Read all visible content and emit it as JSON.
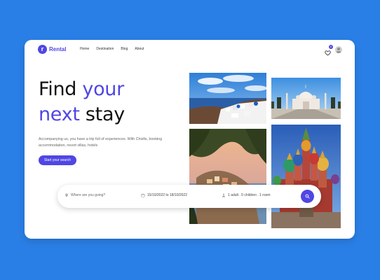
{
  "brand": {
    "logo_letter": "r",
    "name": "Rental",
    "accent": "#5046e4"
  },
  "nav": {
    "items": [
      "Home",
      "Destination",
      "Blog",
      "About"
    ]
  },
  "header": {
    "favorites_count": "0"
  },
  "hero": {
    "title_line1_a": "Find ",
    "title_line1_b": "your",
    "title_line2_a": "next",
    "title_line2_b": " stay",
    "description": "Accompanying us, you have a trip full of experiences. With Chisfis, booking accommodation, resort villas, hotels",
    "cta_label": "Start your search"
  },
  "search": {
    "location_placeholder": "Where are you going?",
    "dates": "15/10/2022 to 18/10/2022",
    "guests": "1 adult . 0 children . 1 room"
  },
  "icons": {
    "heart": "heart-icon",
    "avatar": "user-avatar",
    "location": "location-pin-icon",
    "calendar": "calendar-icon",
    "person": "person-icon",
    "search": "search-icon"
  },
  "colors": {
    "background": "#2a7fe6",
    "accent": "#5046e4"
  }
}
